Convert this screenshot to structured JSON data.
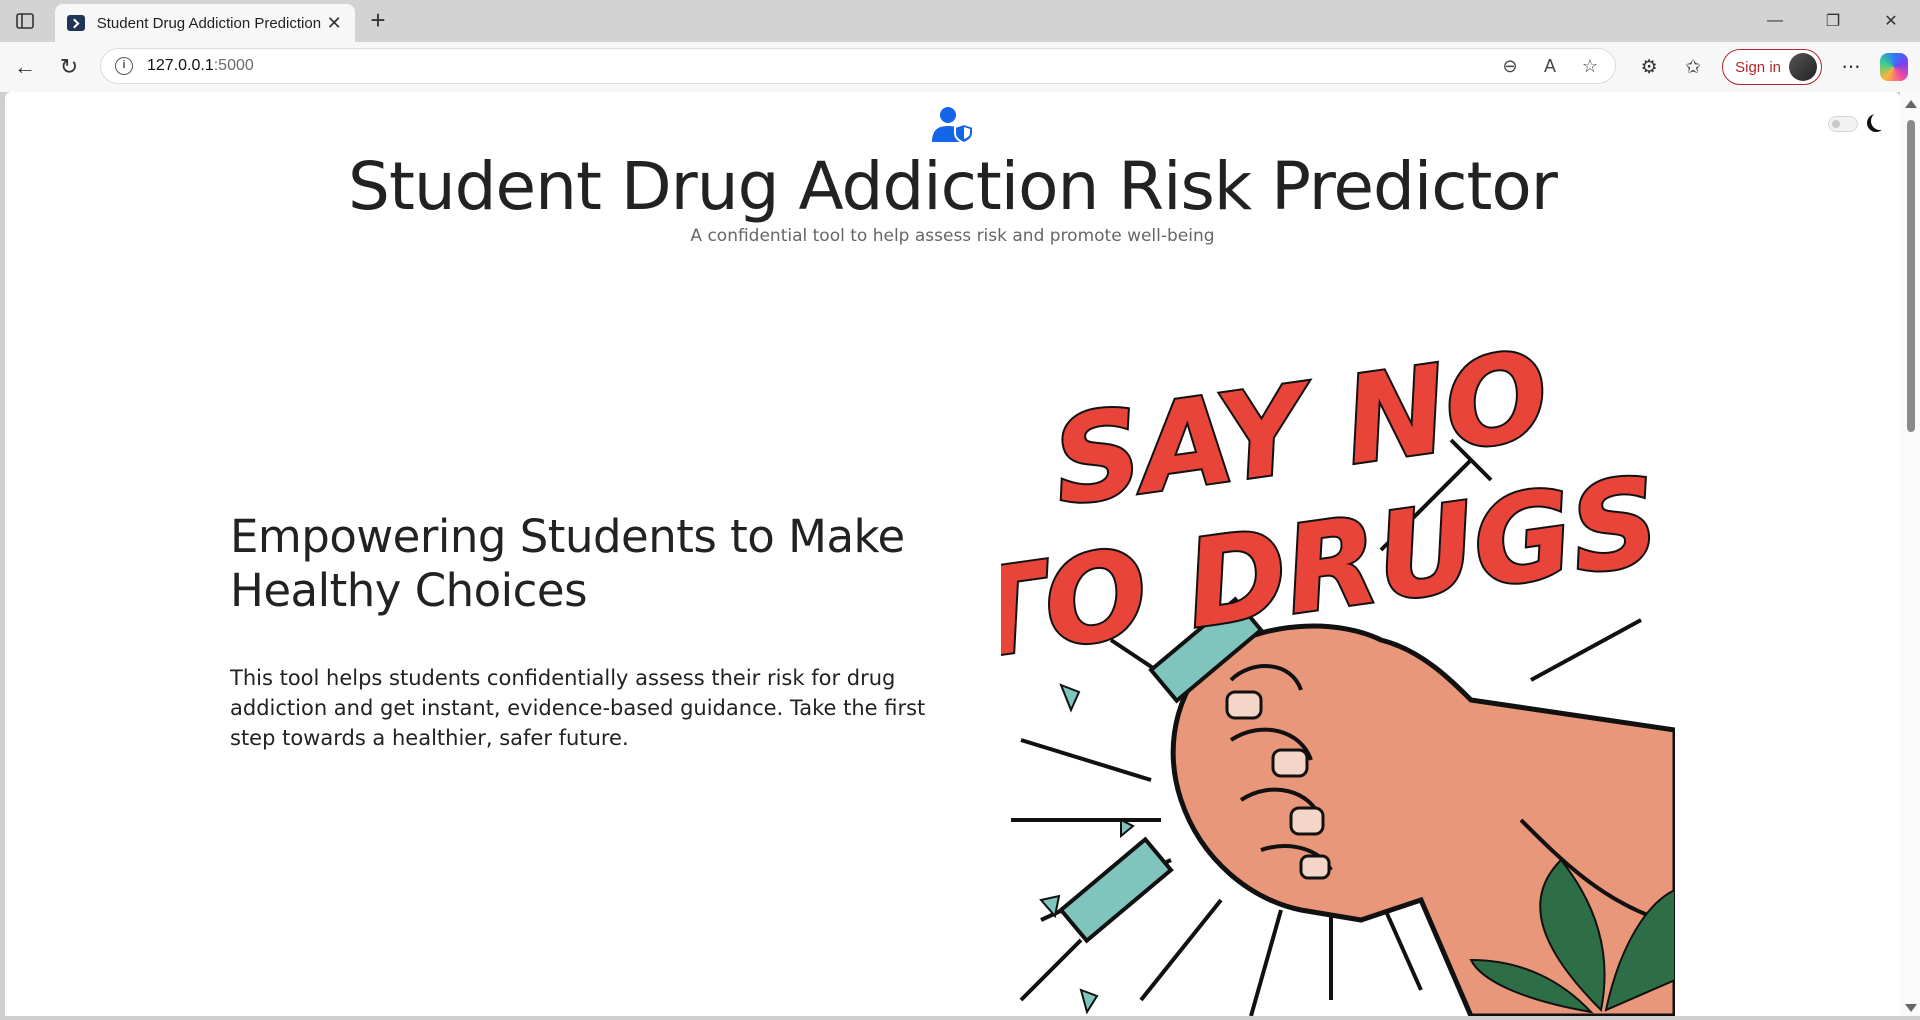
{
  "browser": {
    "tab_title": "Student Drug Addiction Prediction",
    "url_host": "127.0.0.1",
    "url_port": ":5000",
    "signin_label": "Sign in"
  },
  "page": {
    "title": "Student Drug Addiction Risk Predictor",
    "subtitle": "A confidential tool to help assess risk and promote well-being",
    "hero_heading": "Empowering Students to Make Healthy Choices",
    "hero_text": "This tool helps students confidentially assess their risk for drug addiction and get instant, evidence-based guidance. Take the first step towards a healthier, safer future.",
    "poster_line1": "SAY NO",
    "poster_line2": "TO DRUGS"
  },
  "colors": {
    "accent": "#1565e8",
    "poster_red": "#e8443a",
    "signin_red": "#b3262d"
  },
  "icons": [
    "sidebar-icon",
    "back-icon",
    "reload-icon",
    "info-icon",
    "zoom-out-icon",
    "read-aloud-icon",
    "favorite-icon",
    "extensions-icon",
    "favorites-icon",
    "more-icon",
    "copilot-icon",
    "user-shield-icon",
    "moon-icon"
  ]
}
